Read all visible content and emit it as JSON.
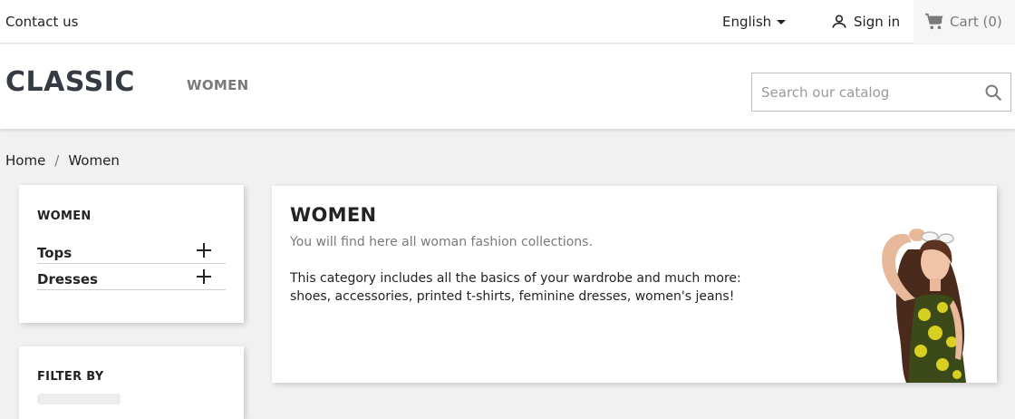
{
  "nav": {
    "contact": "Contact us",
    "language": "English",
    "signin": "Sign in",
    "cart": "Cart (0)"
  },
  "header": {
    "logo": "CLASSIC",
    "menu": [
      "WOMEN"
    ],
    "search_placeholder": "Search our catalog"
  },
  "breadcrumb": {
    "items": [
      "Home",
      "Women"
    ],
    "separator": "/"
  },
  "categories": {
    "title": "WOMEN",
    "items": [
      {
        "label": "Tops",
        "icon": "plus-icon"
      },
      {
        "label": "Dresses",
        "icon": "plus-icon"
      }
    ]
  },
  "filter": {
    "title": "FILTER BY"
  },
  "category_block": {
    "title": "WOMEN",
    "subtitle": "You will find here all woman fashion collections.",
    "description": "This category includes all the basics of your wardrobe and much more: shoes, accessories, printed t-shirts, feminine dresses, women's jeans!"
  },
  "colors": {
    "accent": "#363a42",
    "muted": "#7a7a7a",
    "background": "#f1f1f1"
  }
}
